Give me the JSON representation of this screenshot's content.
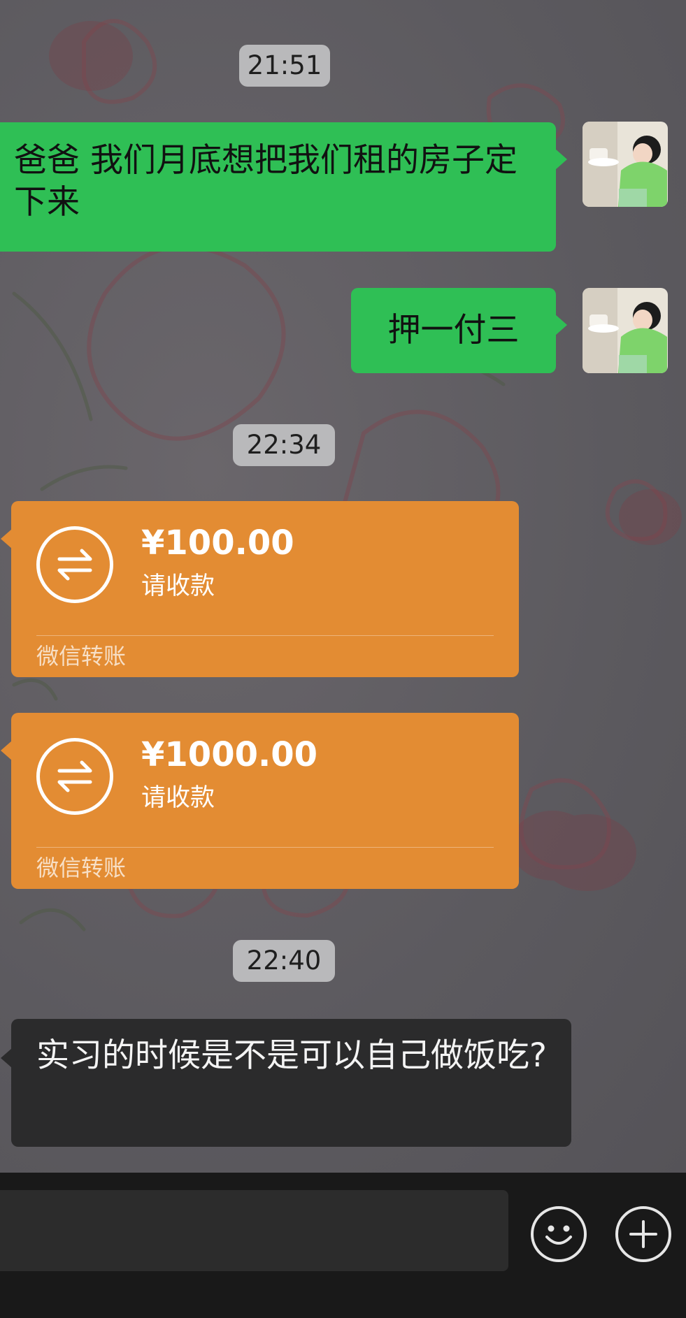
{
  "timestamps": [
    "21:51",
    "22:34",
    "22:40"
  ],
  "messages": {
    "outgoing_1": "爸爸 我们月底想把我们租的房子定下来",
    "outgoing_2": "押一付三",
    "transfer_1": {
      "amount": "¥100.00",
      "note": "请收款",
      "source": "微信转账"
    },
    "transfer_2": {
      "amount": "¥1000.00",
      "note": "请收款",
      "source": "微信转账"
    },
    "incoming_text": "实习的时候是不是可以自己做饭吃?"
  },
  "colors": {
    "outgoing_bubble": "#2fbf55",
    "transfer_card": "#e38c33",
    "incoming_bubble": "#2b2b2c",
    "input_bar": "#191919"
  },
  "icons": {
    "transfer": "transfer-arrows-icon",
    "emoji": "smiley-face-icon",
    "more": "plus-circle-icon"
  }
}
